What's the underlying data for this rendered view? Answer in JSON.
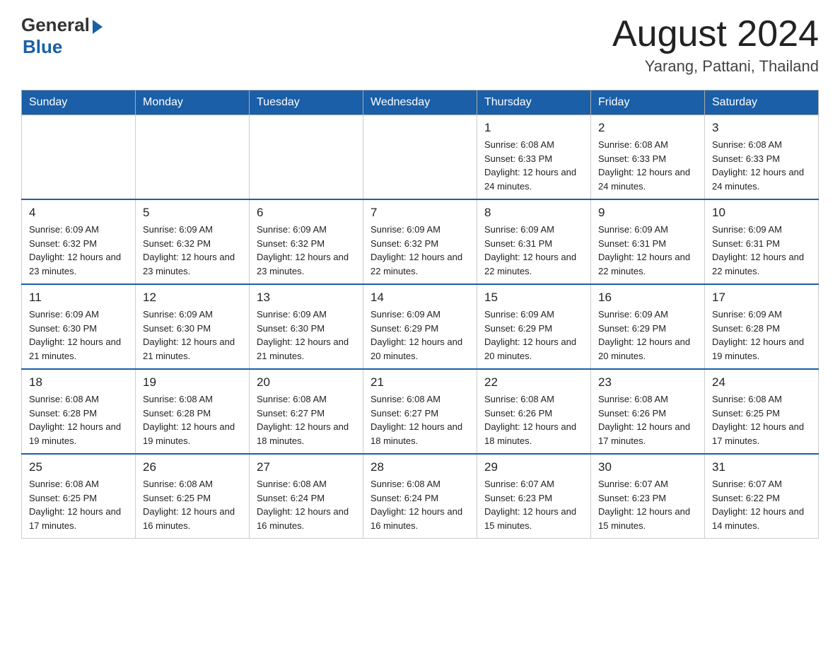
{
  "header": {
    "logo_general": "General",
    "logo_blue": "Blue",
    "month_title": "August 2024",
    "location": "Yarang, Pattani, Thailand"
  },
  "days_of_week": [
    "Sunday",
    "Monday",
    "Tuesday",
    "Wednesday",
    "Thursday",
    "Friday",
    "Saturday"
  ],
  "weeks": [
    [
      {
        "day": "",
        "info": ""
      },
      {
        "day": "",
        "info": ""
      },
      {
        "day": "",
        "info": ""
      },
      {
        "day": "",
        "info": ""
      },
      {
        "day": "1",
        "info": "Sunrise: 6:08 AM\nSunset: 6:33 PM\nDaylight: 12 hours and 24 minutes."
      },
      {
        "day": "2",
        "info": "Sunrise: 6:08 AM\nSunset: 6:33 PM\nDaylight: 12 hours and 24 minutes."
      },
      {
        "day": "3",
        "info": "Sunrise: 6:08 AM\nSunset: 6:33 PM\nDaylight: 12 hours and 24 minutes."
      }
    ],
    [
      {
        "day": "4",
        "info": "Sunrise: 6:09 AM\nSunset: 6:32 PM\nDaylight: 12 hours and 23 minutes."
      },
      {
        "day": "5",
        "info": "Sunrise: 6:09 AM\nSunset: 6:32 PM\nDaylight: 12 hours and 23 minutes."
      },
      {
        "day": "6",
        "info": "Sunrise: 6:09 AM\nSunset: 6:32 PM\nDaylight: 12 hours and 23 minutes."
      },
      {
        "day": "7",
        "info": "Sunrise: 6:09 AM\nSunset: 6:32 PM\nDaylight: 12 hours and 22 minutes."
      },
      {
        "day": "8",
        "info": "Sunrise: 6:09 AM\nSunset: 6:31 PM\nDaylight: 12 hours and 22 minutes."
      },
      {
        "day": "9",
        "info": "Sunrise: 6:09 AM\nSunset: 6:31 PM\nDaylight: 12 hours and 22 minutes."
      },
      {
        "day": "10",
        "info": "Sunrise: 6:09 AM\nSunset: 6:31 PM\nDaylight: 12 hours and 22 minutes."
      }
    ],
    [
      {
        "day": "11",
        "info": "Sunrise: 6:09 AM\nSunset: 6:30 PM\nDaylight: 12 hours and 21 minutes."
      },
      {
        "day": "12",
        "info": "Sunrise: 6:09 AM\nSunset: 6:30 PM\nDaylight: 12 hours and 21 minutes."
      },
      {
        "day": "13",
        "info": "Sunrise: 6:09 AM\nSunset: 6:30 PM\nDaylight: 12 hours and 21 minutes."
      },
      {
        "day": "14",
        "info": "Sunrise: 6:09 AM\nSunset: 6:29 PM\nDaylight: 12 hours and 20 minutes."
      },
      {
        "day": "15",
        "info": "Sunrise: 6:09 AM\nSunset: 6:29 PM\nDaylight: 12 hours and 20 minutes."
      },
      {
        "day": "16",
        "info": "Sunrise: 6:09 AM\nSunset: 6:29 PM\nDaylight: 12 hours and 20 minutes."
      },
      {
        "day": "17",
        "info": "Sunrise: 6:09 AM\nSunset: 6:28 PM\nDaylight: 12 hours and 19 minutes."
      }
    ],
    [
      {
        "day": "18",
        "info": "Sunrise: 6:08 AM\nSunset: 6:28 PM\nDaylight: 12 hours and 19 minutes."
      },
      {
        "day": "19",
        "info": "Sunrise: 6:08 AM\nSunset: 6:28 PM\nDaylight: 12 hours and 19 minutes."
      },
      {
        "day": "20",
        "info": "Sunrise: 6:08 AM\nSunset: 6:27 PM\nDaylight: 12 hours and 18 minutes."
      },
      {
        "day": "21",
        "info": "Sunrise: 6:08 AM\nSunset: 6:27 PM\nDaylight: 12 hours and 18 minutes."
      },
      {
        "day": "22",
        "info": "Sunrise: 6:08 AM\nSunset: 6:26 PM\nDaylight: 12 hours and 18 minutes."
      },
      {
        "day": "23",
        "info": "Sunrise: 6:08 AM\nSunset: 6:26 PM\nDaylight: 12 hours and 17 minutes."
      },
      {
        "day": "24",
        "info": "Sunrise: 6:08 AM\nSunset: 6:25 PM\nDaylight: 12 hours and 17 minutes."
      }
    ],
    [
      {
        "day": "25",
        "info": "Sunrise: 6:08 AM\nSunset: 6:25 PM\nDaylight: 12 hours and 17 minutes."
      },
      {
        "day": "26",
        "info": "Sunrise: 6:08 AM\nSunset: 6:25 PM\nDaylight: 12 hours and 16 minutes."
      },
      {
        "day": "27",
        "info": "Sunrise: 6:08 AM\nSunset: 6:24 PM\nDaylight: 12 hours and 16 minutes."
      },
      {
        "day": "28",
        "info": "Sunrise: 6:08 AM\nSunset: 6:24 PM\nDaylight: 12 hours and 16 minutes."
      },
      {
        "day": "29",
        "info": "Sunrise: 6:07 AM\nSunset: 6:23 PM\nDaylight: 12 hours and 15 minutes."
      },
      {
        "day": "30",
        "info": "Sunrise: 6:07 AM\nSunset: 6:23 PM\nDaylight: 12 hours and 15 minutes."
      },
      {
        "day": "31",
        "info": "Sunrise: 6:07 AM\nSunset: 6:22 PM\nDaylight: 12 hours and 14 minutes."
      }
    ]
  ]
}
